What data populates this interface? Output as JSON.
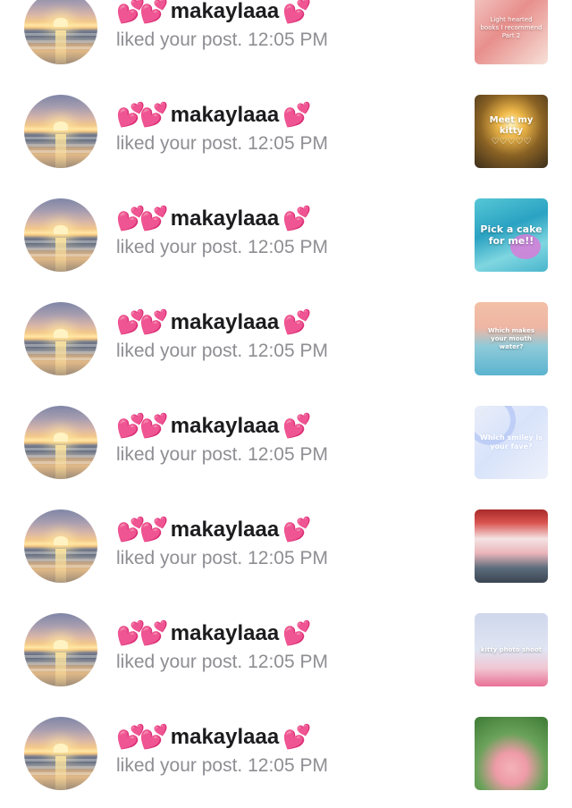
{
  "notifications": [
    {
      "hearts_before": "💕💕",
      "username": "makaylaaa",
      "hearts_after": "💕",
      "action": "liked your post.",
      "time": "12:05 PM",
      "thumb_caption": "Light hearted books I recommend Part 2"
    },
    {
      "hearts_before": "💕💕",
      "username": "makaylaaa",
      "hearts_after": "💕",
      "action": "liked your post.",
      "time": "12:05 PM",
      "thumb_caption": "Meet my kitty ♡♡♡♡♡"
    },
    {
      "hearts_before": "💕💕",
      "username": "makaylaaa",
      "hearts_after": "💕",
      "action": "liked your post.",
      "time": "12:05 PM",
      "thumb_caption": "Pick a cake for me!!"
    },
    {
      "hearts_before": "💕💕",
      "username": "makaylaaa",
      "hearts_after": "💕",
      "action": "liked your post.",
      "time": "12:05 PM",
      "thumb_caption": "Which makes your mouth water?"
    },
    {
      "hearts_before": "💕💕",
      "username": "makaylaaa",
      "hearts_after": "💕",
      "action": "liked your post.",
      "time": "12:05 PM",
      "thumb_caption": "Which smiley is your fave?"
    },
    {
      "hearts_before": "💕💕",
      "username": "makaylaaa",
      "hearts_after": "💕",
      "action": "liked your post.",
      "time": "12:05 PM",
      "thumb_caption": ""
    },
    {
      "hearts_before": "💕💕",
      "username": "makaylaaa",
      "hearts_after": "💕",
      "action": "liked your post.",
      "time": "12:05 PM",
      "thumb_caption": "kitty photo shoot"
    },
    {
      "hearts_before": "💕💕",
      "username": "makaylaaa",
      "hearts_after": "💕",
      "action": "liked your post.",
      "time": "12:05 PM",
      "thumb_caption": ""
    }
  ],
  "colors": {
    "username": "#1c1c1e",
    "secondary_text": "#8e8e93",
    "heart": "#e23b9a",
    "background": "#ffffff"
  },
  "icons": {
    "avatar": "sunset-beach-avatar",
    "heart": "two-hearts-emoji"
  }
}
